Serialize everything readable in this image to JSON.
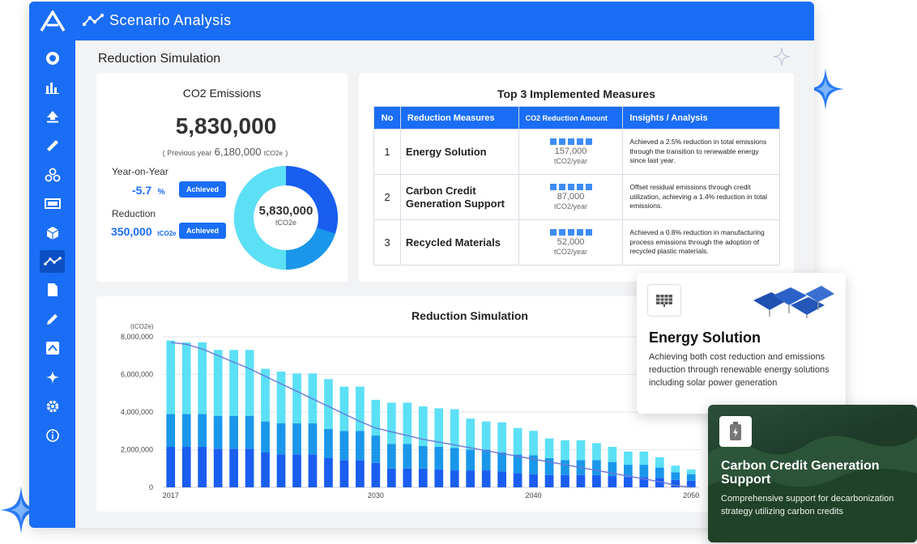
{
  "header": {
    "app_title": "Scenario Analysis"
  },
  "page": {
    "title": "Reduction Simulation"
  },
  "sidebar": {
    "icons": [
      "donut-chart-icon",
      "bar-chart-icon",
      "upload-icon",
      "ruler-icon",
      "network-icon",
      "monitor-icon",
      "cube-icon",
      "line-chart-icon",
      "document-icon",
      "pen-icon",
      "image-icon",
      "sparkle-icon",
      "gear-icon",
      "info-icon"
    ]
  },
  "co2": {
    "title": "CO2 Emissions",
    "value": "5,830,000",
    "prev_open": "( Previous year",
    "prev_value": "6,180,000",
    "prev_unit": "tCO2e",
    "prev_close": ")",
    "yoy_label": "Year-on-Year",
    "yoy_value": "-5.7",
    "yoy_unit": "%",
    "badge": "Achieved",
    "reduction_label": "Reduction",
    "reduction_value": "350,000",
    "reduction_unit": "tCO2e",
    "donut_value": "5,830,000",
    "donut_unit": "tCO2e"
  },
  "top3": {
    "title": "Top 3 Implemented Measures",
    "headers": [
      "No",
      "Reduction Measures",
      "CO2 Reduction Amount",
      "Insights / Analysis"
    ],
    "rows": [
      {
        "no": "1",
        "measure": "Energy Solution",
        "amount": "157,000",
        "unit": "tCO2/year",
        "insight": "Achieved a 2.5% reduction in total emissions through the transition to renewable energy since last year."
      },
      {
        "no": "2",
        "measure": "Carbon Credit Generation Support",
        "amount": "87,000",
        "unit": "tCO2/year",
        "insight": "Offset residual emissions through credit utilization, achieving a 1.4% reduction in total emissions."
      },
      {
        "no": "3",
        "measure": "Recycled Materials",
        "amount": "52,000",
        "unit": "tCO2/year",
        "insight": "Achieved a 0.8% reduction in manufacturing process emissions through the adoption of recycled plastic materials."
      }
    ]
  },
  "sim": {
    "title": "Reduction Simulation"
  },
  "popups": {
    "energy": {
      "title": "Energy Solution",
      "text": "Achieving both cost reduction and emissions reduction through renewable energy solutions including solar power generation"
    },
    "carbon": {
      "title": "Carbon Credit Generation Support",
      "text": "Comprehensive support for decarbonization strategy utilizing carbon credits"
    }
  },
  "chart_data": {
    "type": "bar",
    "title": "Reduction Simulation",
    "ylabel": "(tCO2e)",
    "ylim": [
      0,
      8000000
    ],
    "yticks": [
      "8,000,000",
      "6,000,000",
      "4,000,000",
      "2,000,000",
      "0"
    ],
    "xtick_labels": [
      "2017",
      "2030",
      "2040",
      "2050"
    ],
    "x": [
      2017,
      2018,
      2019,
      2020,
      2021,
      2022,
      2023,
      2024,
      2025,
      2026,
      2027,
      2028,
      2029,
      2030,
      2031,
      2032,
      2033,
      2034,
      2035,
      2036,
      2037,
      2038,
      2039,
      2040,
      2041,
      2042,
      2043,
      2044,
      2045,
      2046,
      2047,
      2048,
      2049,
      2050
    ],
    "series": [
      {
        "color": "#1a5ef0",
        "values": [
          2150000,
          2150000,
          2150000,
          2050000,
          2050000,
          2050000,
          1850000,
          1750000,
          1750000,
          1750000,
          1550000,
          1450000,
          1450000,
          1300000,
          1000000,
          1000000,
          1000000,
          950000,
          900000,
          900000,
          900000,
          850000,
          750000,
          700000,
          650000,
          650000,
          650000,
          650000,
          600000,
          550000,
          550000,
          500000,
          400000,
          350000
        ]
      },
      {
        "color": "#1a97ea",
        "values": [
          1750000,
          1750000,
          1750000,
          1750000,
          1750000,
          1750000,
          1650000,
          1650000,
          1650000,
          1650000,
          1550000,
          1550000,
          1550000,
          1450000,
          1300000,
          1300000,
          1200000,
          1200000,
          1200000,
          1100000,
          1100000,
          1000000,
          1000000,
          1000000,
          900000,
          800000,
          800000,
          800000,
          750000,
          650000,
          650000,
          550000,
          400000,
          350000
        ]
      },
      {
        "color": "#5ce0f5",
        "values": [
          3900000,
          3800000,
          3800000,
          3500000,
          3500000,
          3500000,
          2800000,
          2750000,
          2650000,
          2650000,
          2650000,
          2350000,
          2350000,
          1900000,
          2200000,
          2200000,
          2100000,
          2050000,
          2050000,
          1650000,
          1500000,
          1600000,
          1400000,
          1300000,
          1050000,
          1050000,
          1050000,
          900000,
          800000,
          700000,
          700000,
          550000,
          350000,
          250000
        ]
      }
    ],
    "trend_line_color": "#6a78d8",
    "trend_line_values": [
      7700000,
      7600000,
      7350000,
      7000000,
      6650000,
      6300000,
      5900000,
      5500000,
      5100000,
      4700000,
      4300000,
      3900000,
      3500000,
      3150000,
      2950000,
      2750000,
      2550000,
      2400000,
      2250000,
      2100000,
      1950000,
      1800000,
      1650000,
      1500000,
      1350000,
      1200000,
      1050000,
      900000,
      750000,
      600000,
      450000,
      300000,
      100000,
      0
    ]
  }
}
